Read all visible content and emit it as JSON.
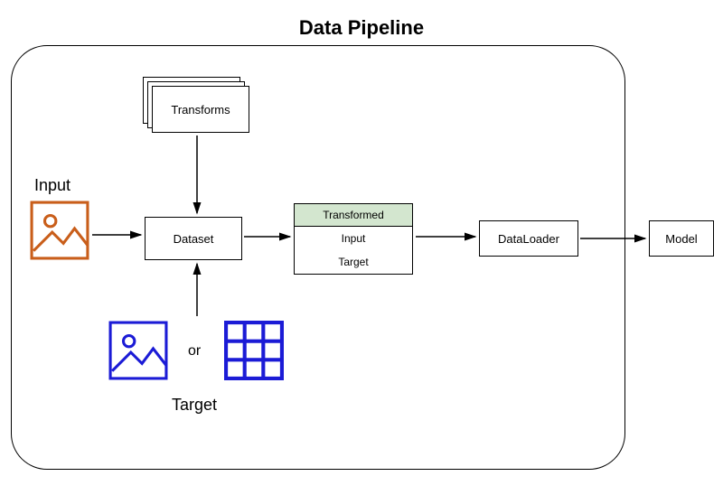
{
  "title": "Data Pipeline",
  "input": {
    "label": "Input"
  },
  "transforms": {
    "label": "Transforms"
  },
  "dataset": {
    "label": "Dataset"
  },
  "transformed": {
    "header": "Transformed",
    "input_row": "Input",
    "target_row": "Target"
  },
  "dataloader": {
    "label": "DataLoader"
  },
  "model": {
    "label": "Model"
  },
  "target": {
    "label": "Target",
    "or": "or"
  },
  "colors": {
    "input_icon": "#c95e1a",
    "target_icon": "#1b1bd6",
    "transformed_header_bg": "#d3e6cf"
  }
}
